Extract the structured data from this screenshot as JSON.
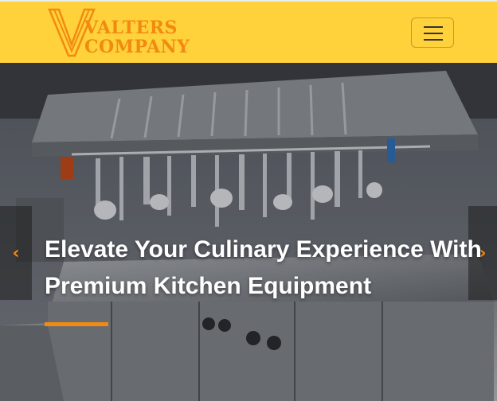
{
  "brand": {
    "line1": "VALTERS",
    "line2": "COMPANY",
    "accent_color": "#f28a12",
    "navbar_color": "#ffd13a"
  },
  "nav": {
    "toggler_icon": "hamburger-icon"
  },
  "hero": {
    "heading_line1": "Elevate Your Culinary Experience With",
    "heading_line2": "Premium Kitchen Equipment",
    "prev_icon": "‹",
    "next_icon": "›"
  }
}
